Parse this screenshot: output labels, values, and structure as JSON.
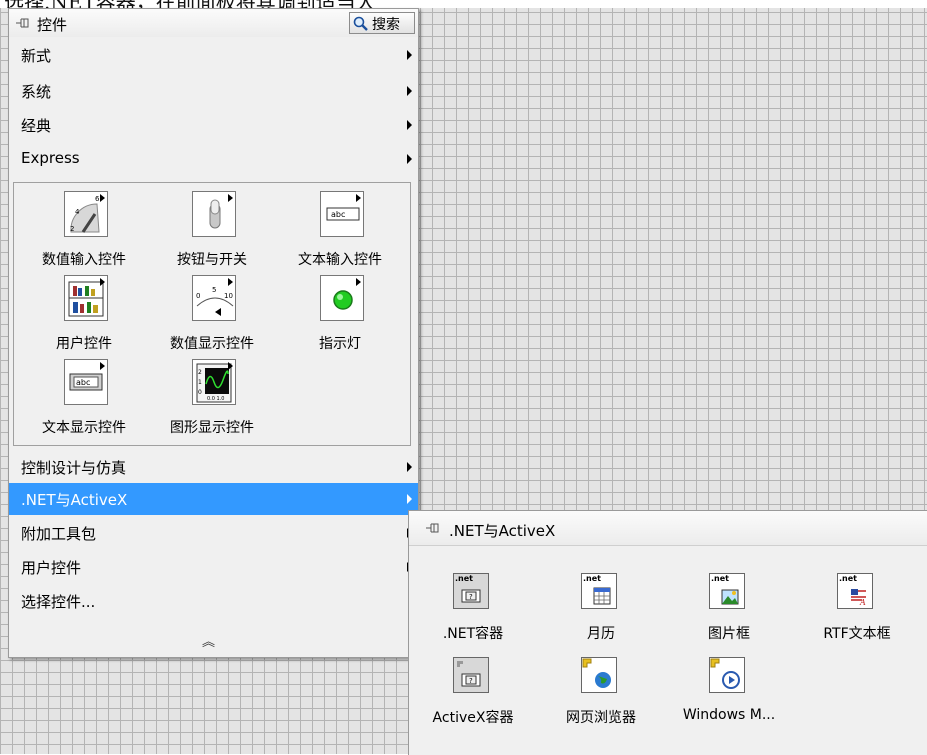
{
  "caption": "选择.NET容器，在前面板将其调到适当大",
  "palette": {
    "title": "控件",
    "search_label": "搜索",
    "categories": [
      {
        "label": "新式",
        "submenu": true
      },
      {
        "label": "系统",
        "submenu": true
      },
      {
        "label": "经典",
        "submenu": true
      },
      {
        "label": "Express",
        "submenu": true
      }
    ],
    "controls": [
      {
        "label": "数值输入控件",
        "icon": "knob-icon"
      },
      {
        "label": "按钮与开关",
        "icon": "toggle-switch-icon"
      },
      {
        "label": "文本输入控件",
        "icon": "text-input-icon"
      },
      {
        "label": "用户控件",
        "icon": "user-controls-icon"
      },
      {
        "label": "数值显示控件",
        "icon": "meter-icon"
      },
      {
        "label": "指示灯",
        "icon": "led-icon"
      },
      {
        "label": "文本显示控件",
        "icon": "text-display-icon"
      },
      {
        "label": "图形显示控件",
        "icon": "graph-icon"
      }
    ],
    "more_categories": [
      {
        "label": "控制设计与仿真",
        "submenu": true,
        "selected": false
      },
      {
        "label": ".NET与ActiveX",
        "submenu": true,
        "selected": true
      },
      {
        "label": "附加工具包",
        "submenu": true,
        "selected": false
      },
      {
        "label": "用户控件",
        "submenu": true,
        "selected": false
      },
      {
        "label": "选择控件...",
        "submenu": false,
        "selected": false
      }
    ],
    "collapse_glyph": "︽"
  },
  "subpalette": {
    "title": ".NET与ActiveX",
    "items": [
      {
        "label": ".NET容器",
        "icon": "net-container-icon",
        "badge": ".net"
      },
      {
        "label": "月历",
        "icon": "calendar-icon",
        "badge": ".net"
      },
      {
        "label": "图片框",
        "icon": "picture-box-icon",
        "badge": ".net"
      },
      {
        "label": "RTF文本框",
        "icon": "rtf-textbox-icon",
        "badge": ".net"
      },
      {
        "label": "ActiveX容器",
        "icon": "activex-container-icon",
        "badge": ""
      },
      {
        "label": "网页浏览器",
        "icon": "web-browser-icon",
        "badge": ""
      },
      {
        "label": "Windows M...",
        "icon": "media-player-icon",
        "badge": ""
      }
    ]
  },
  "colors": {
    "selection": "#3399ff",
    "panel": "#f0f0f0",
    "grid_line": "#b4b4b4",
    "led_green": "#22cc22"
  }
}
